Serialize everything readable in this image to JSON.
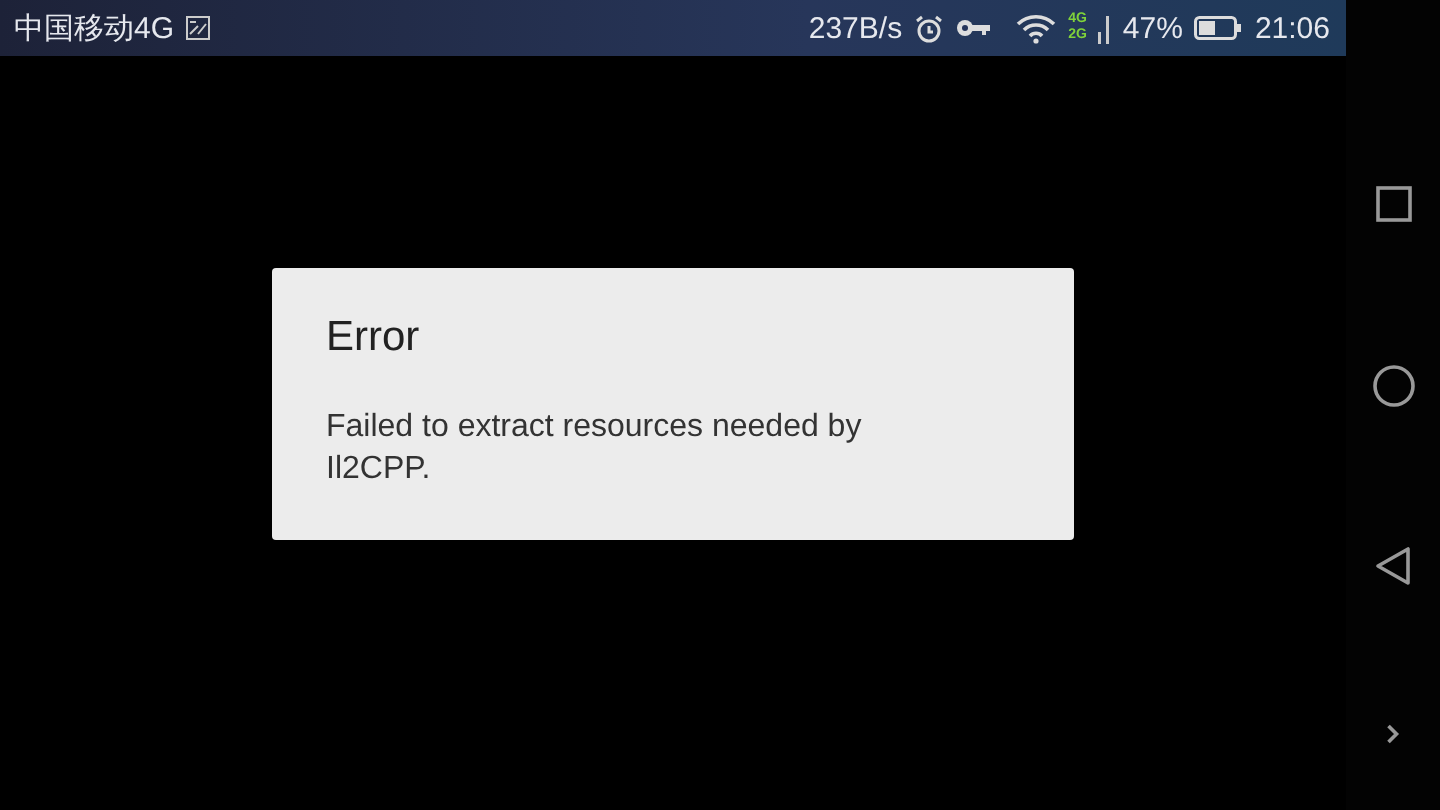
{
  "status_bar": {
    "carrier": "中国移动4G",
    "speed": "237B/s",
    "network_top": "4G",
    "network_bottom": "2G",
    "battery": "47%",
    "time": "21:06"
  },
  "dialog": {
    "title": "Error",
    "message": "Failed to extract resources needed by Il2CPP."
  },
  "nav_bar": {
    "buttons": [
      {
        "kind": "recents"
      },
      {
        "kind": "home"
      },
      {
        "kind": "back"
      },
      {
        "kind": "expand"
      }
    ]
  }
}
